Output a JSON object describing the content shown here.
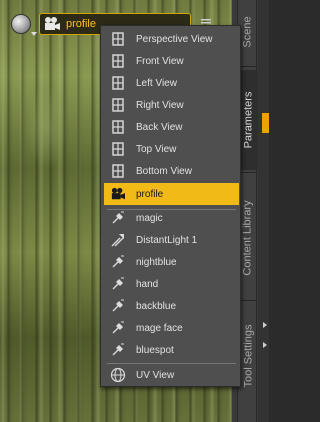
{
  "camera_selector": {
    "current": "profile",
    "icon": "movie-camera-icon"
  },
  "side_tabs": [
    {
      "label": "Scene",
      "active": false
    },
    {
      "label": "Parameters",
      "active": true
    },
    {
      "label": "Content Library",
      "active": false
    },
    {
      "label": "Tool Settings",
      "active": false
    }
  ],
  "menu": {
    "view_items": [
      {
        "label": "Perspective View",
        "icon": "view-grid-icon"
      },
      {
        "label": "Front View",
        "icon": "view-grid-icon"
      },
      {
        "label": "Left View",
        "icon": "view-grid-icon"
      },
      {
        "label": "Right View",
        "icon": "view-grid-icon"
      },
      {
        "label": "Back View",
        "icon": "view-grid-icon"
      },
      {
        "label": "Top View",
        "icon": "view-grid-icon"
      },
      {
        "label": "Bottom View",
        "icon": "view-grid-icon"
      }
    ],
    "camera_items": [
      {
        "label": "profile",
        "icon": "movie-camera-icon",
        "selected": true
      }
    ],
    "light_items": [
      {
        "label": "magic",
        "icon": "spotlight-icon"
      },
      {
        "label": "DistantLight 1",
        "icon": "distant-light-icon"
      },
      {
        "label": "nightblue",
        "icon": "spotlight-icon"
      },
      {
        "label": "hand",
        "icon": "spotlight-icon"
      },
      {
        "label": "backblue",
        "icon": "spotlight-icon"
      },
      {
        "label": "mage face",
        "icon": "spotlight-icon"
      },
      {
        "label": "bluespot",
        "icon": "spotlight-icon"
      }
    ],
    "extra_items": [
      {
        "label": "UV View",
        "icon": "globe-icon"
      }
    ]
  },
  "colors": {
    "accent": "#f2ba16",
    "accent_text": "#ffc01a",
    "menu_bg": "#4f4f4f"
  }
}
